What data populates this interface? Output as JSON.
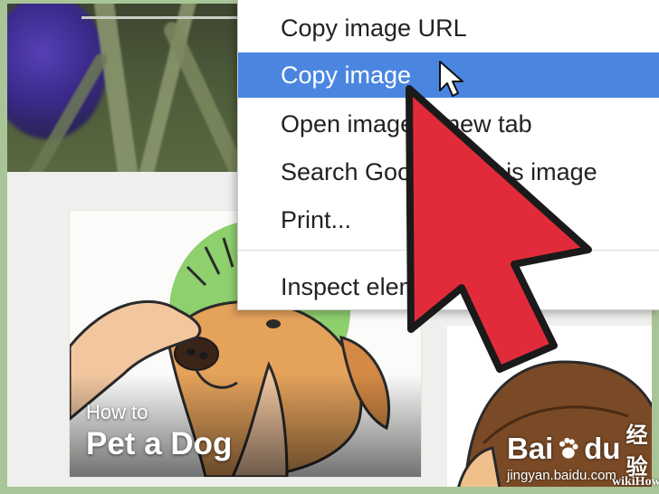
{
  "background_photo": {
    "card_left": {
      "caption_small": "How to",
      "caption_big": "Pet a Dog"
    }
  },
  "context_menu": {
    "items": [
      {
        "label": "Copy image URL",
        "highlighted": false
      },
      {
        "label": "Copy image",
        "highlighted": true
      },
      {
        "label": "Open image in new tab",
        "highlighted": false
      },
      {
        "label": "Search Google for this image",
        "highlighted": false
      },
      {
        "label": "Print...",
        "highlighted": false
      },
      {
        "label": "Inspect element",
        "highlighted": false
      }
    ],
    "highlight_color": "#4a86e0"
  },
  "annotation": {
    "arrow_icon": "big-red-arrow-icon",
    "arrow_color": "#e22b3a",
    "cursor_icon": "mouse-pointer-icon"
  },
  "watermarks": {
    "baidu_brand_a": "Bai",
    "baidu_brand_b": "du",
    "baidu_cn": "经验",
    "baidu_url": "jingyan.baidu.com",
    "wikihow": "wikiHow"
  }
}
